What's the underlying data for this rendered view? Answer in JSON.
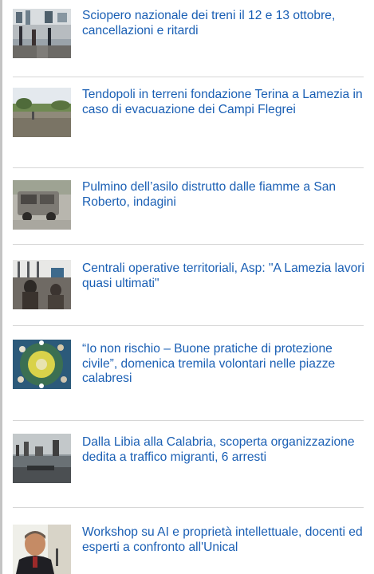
{
  "news": {
    "items": [
      {
        "title": "Sciopero nazionale dei treni il 12 e 13 ottobre, cancellazioni e ritardi",
        "thumb_icon": "train-station-photo-icon"
      },
      {
        "title": "Tendopoli in terreni fondazione Terina a Lamezia in caso di evacuazione dei Campi Flegrei",
        "thumb_icon": "field-photo-icon"
      },
      {
        "title": "Pulmino dell’asilo distrutto dalle fiamme a San Roberto, indagini",
        "thumb_icon": "burned-van-photo-icon"
      },
      {
        "title": "Centrali operative territoriali, Asp: \"A Lamezia lavori quasi ultimati\"",
        "thumb_icon": "office-photo-icon"
      },
      {
        "title": "“Io non rischio – Buone pratiche di protezione civile”, domenica tremila volontari nelle piazze calabresi",
        "thumb_icon": "volunteers-photo-icon"
      },
      {
        "title": "Dalla Libia alla Calabria, scoperta organizzazione dedita a traffico migranti, 6 arresti",
        "thumb_icon": "harbor-photo-icon"
      },
      {
        "title": "Workshop su AI e proprietà intellettuale, docenti ed esperti a confronto all'Unical",
        "thumb_icon": "speaker-photo-icon"
      }
    ]
  }
}
